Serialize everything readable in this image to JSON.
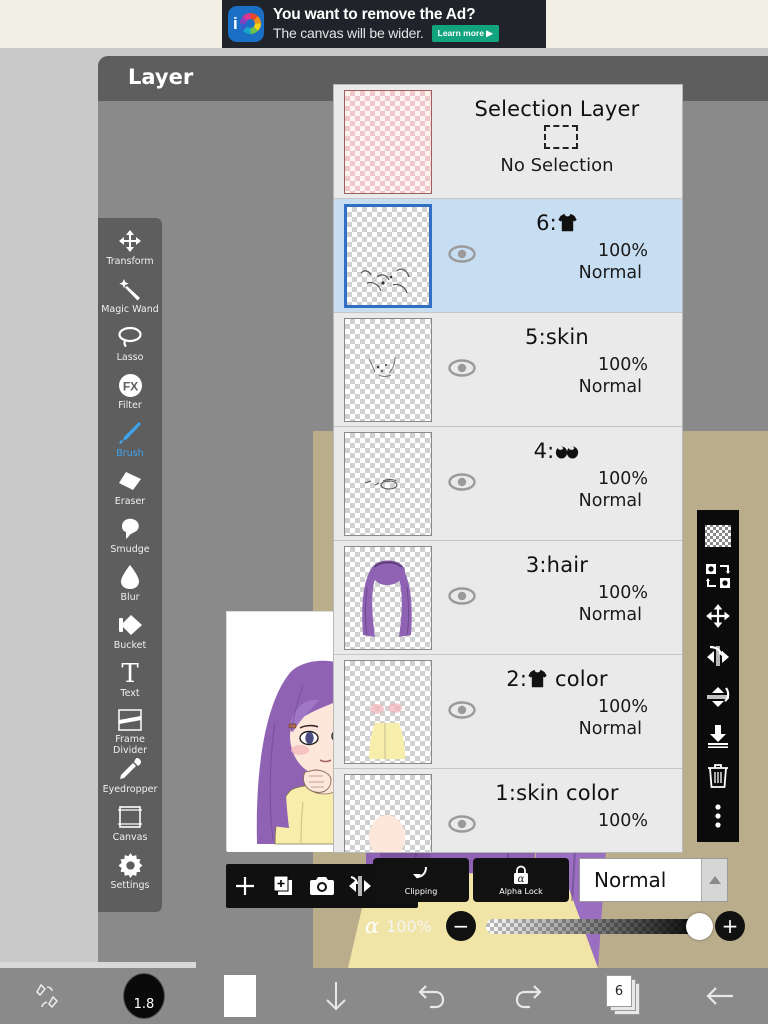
{
  "ad": {
    "headline": "You want to remove the Ad?",
    "subline": "The canvas will be wider.",
    "cta_label": "Learn more ▶",
    "logo_name": "ibispaint-logo",
    "bg_color": "#20242a",
    "cta_color": "#12a37f"
  },
  "app": {
    "header_title": "Layer",
    "window_bg": "#8a8a8a",
    "header_bg": "#5e5e5e"
  },
  "left_toolbar": {
    "items": [
      {
        "label": "Transform",
        "icon": "move-arrows-icon",
        "active": false
      },
      {
        "label": "Magic Wand",
        "icon": "magic-wand-icon",
        "active": false
      },
      {
        "label": "Lasso",
        "icon": "lasso-icon",
        "active": false
      },
      {
        "label": "Filter",
        "icon": "fx-icon",
        "active": false
      },
      {
        "label": "Brush",
        "icon": "brush-icon",
        "active": true
      },
      {
        "label": "Eraser",
        "icon": "eraser-icon",
        "active": false
      },
      {
        "label": "Smudge",
        "icon": "smudge-icon",
        "active": false
      },
      {
        "label": "Blur",
        "icon": "blur-drop-icon",
        "active": false
      },
      {
        "label": "Bucket",
        "icon": "paint-bucket-icon",
        "active": false
      },
      {
        "label": "Text",
        "icon": "text-t-icon",
        "active": false
      },
      {
        "label": "Frame Divider",
        "icon": "frame-divider-icon",
        "active": false
      },
      {
        "label": "Eyedropper",
        "icon": "eyedropper-icon",
        "active": false
      },
      {
        "label": "Canvas",
        "icon": "canvas-square-icon",
        "active": false
      },
      {
        "label": "Settings",
        "icon": "gear-icon",
        "active": false
      }
    ],
    "active_color": "#3da5f0"
  },
  "preview_toolbar": {
    "buttons": [
      {
        "name": "add-layer-button",
        "icon": "plus-icon"
      },
      {
        "name": "duplicate-layer-button",
        "icon": "duplicate-icon"
      },
      {
        "name": "camera-button",
        "icon": "camera-icon"
      },
      {
        "name": "flip-horizontal-button",
        "icon": "flip-horizontal-icon"
      },
      {
        "name": "flip-vertical-button",
        "icon": "flip-vertical-icon"
      }
    ]
  },
  "layer_panel": {
    "selection_layer": {
      "title": "Selection Layer",
      "status": "No Selection",
      "thumb_style": "pink-checker"
    },
    "layers": [
      {
        "name": "6:",
        "glyph": "tshirt",
        "glyph_after": "",
        "opacity": "100%",
        "blend": "Normal",
        "visible": true,
        "selected": true,
        "thumb": "sketch-sparse"
      },
      {
        "name": "5:skin",
        "glyph": "",
        "glyph_after": "",
        "opacity": "100%",
        "blend": "Normal",
        "visible": true,
        "selected": false,
        "thumb": "sketch-faint"
      },
      {
        "name": "4:",
        "glyph": "eyes",
        "glyph_after": "",
        "opacity": "100%",
        "blend": "Normal",
        "visible": true,
        "selected": false,
        "thumb": "eyes-sketch"
      },
      {
        "name": "3:hair",
        "glyph": "",
        "glyph_after": "",
        "opacity": "100%",
        "blend": "Normal",
        "visible": true,
        "selected": false,
        "thumb": "purple-hair"
      },
      {
        "name": "2:",
        "glyph": "tshirt",
        "glyph_after": " color",
        "opacity": "100%",
        "blend": "Normal",
        "visible": true,
        "selected": false,
        "thumb": "yellow-sweater"
      },
      {
        "name": "1:skin color",
        "glyph": "",
        "glyph_after": "",
        "opacity": "100%",
        "blend": "",
        "visible": true,
        "selected": false,
        "thumb": "skin-tone"
      }
    ],
    "selected_bg": "#c7ddf2",
    "panel_bg": "#eaeaea"
  },
  "right_toolbar": {
    "buttons": [
      {
        "name": "transparency-checker-button",
        "icon": "checkerboard-icon"
      },
      {
        "name": "swap-layers-button",
        "icon": "swap-icon"
      },
      {
        "name": "move-layer-button",
        "icon": "move-arrows-icon"
      },
      {
        "name": "flip-horizontal-layer-button",
        "icon": "flip-horizontal-icon"
      },
      {
        "name": "flip-vertical-layer-button",
        "icon": "flip-vertical-icon"
      },
      {
        "name": "merge-down-button",
        "icon": "merge-down-icon"
      },
      {
        "name": "delete-layer-button",
        "icon": "trash-icon"
      },
      {
        "name": "more-options-button",
        "icon": "more-vertical-icon"
      }
    ]
  },
  "blend_controls": {
    "clipping_label": "Clipping",
    "alpha_lock_label": "Alpha Lock",
    "blend_mode_value": "Normal",
    "alpha_symbol": "α",
    "alpha_value": "100%",
    "minus_label": "−",
    "plus_label": "+"
  },
  "bottom_bar": {
    "items": [
      {
        "name": "brush-settings-button",
        "icon": "brush-stroke-icon",
        "label": ""
      },
      {
        "name": "brush-size-button",
        "icon": "brush-size-circle",
        "label": "1.8"
      },
      {
        "name": "color-swatch-button",
        "icon": "color-swatch",
        "label": ""
      },
      {
        "name": "download-button",
        "icon": "arrow-down-icon",
        "label": ""
      },
      {
        "name": "undo-button",
        "icon": "undo-icon",
        "label": ""
      },
      {
        "name": "redo-button",
        "icon": "redo-icon",
        "label": ""
      },
      {
        "name": "layers-button",
        "icon": "layer-stack-icon",
        "label": "6"
      },
      {
        "name": "back-button",
        "icon": "arrow-left-icon",
        "label": ""
      }
    ]
  },
  "artwork": {
    "description": "Anime girl with long purple hair, yellow sweater, hand near chin",
    "hair_color": "#8f62b4",
    "hair_shadow": "#6f4a8e",
    "sweater_color": "#f7eeab",
    "skin_color": "#fde7da",
    "blush_color": "#f2b7bb",
    "line_color": "#1a1a1a",
    "bg_wall_color": "#b9ad8c"
  }
}
